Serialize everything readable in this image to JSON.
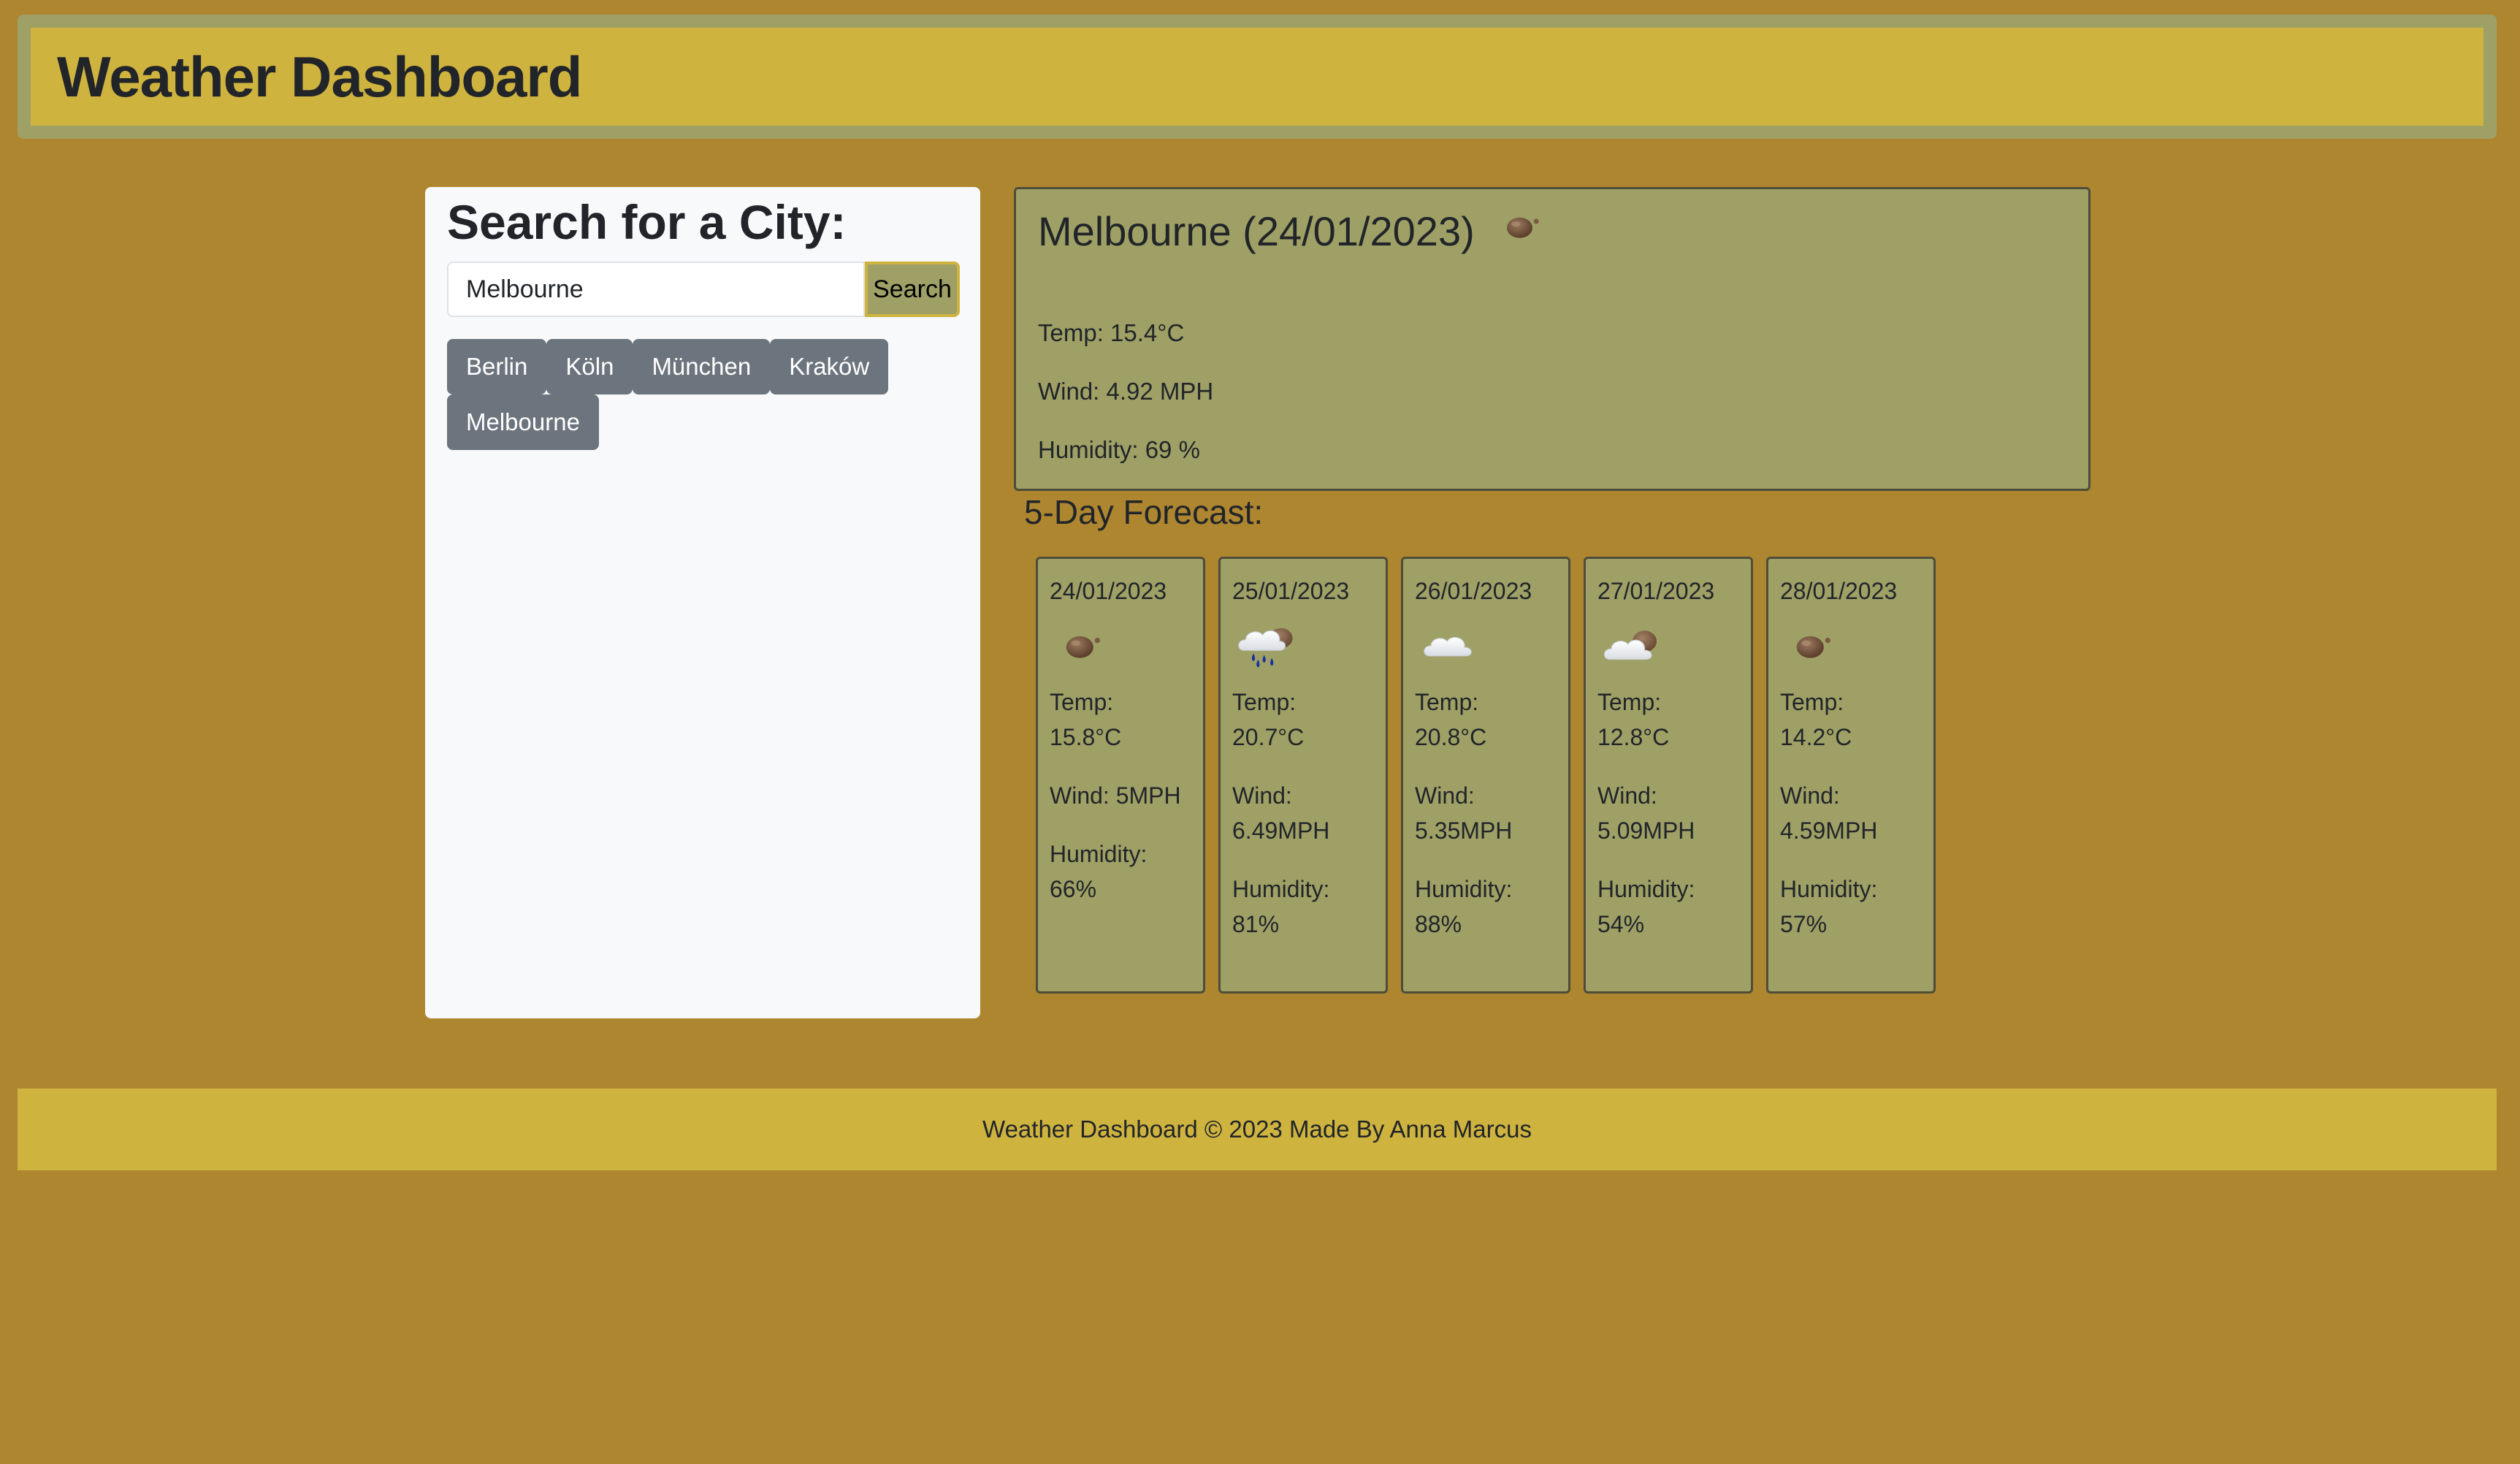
{
  "header": {
    "title": "Weather Dashboard"
  },
  "search": {
    "title": "Search for a City:",
    "input_value": "Melbourne",
    "button_label": "Search",
    "history": [
      "Berlin",
      "Köln",
      "München",
      "Kraków",
      "Melbourne"
    ]
  },
  "current": {
    "title": "Melbourne (24/01/2023)",
    "icon": "clear-night-icon",
    "temp": "Temp: 15.4°C",
    "wind": "Wind: 4.92 MPH",
    "humidity": "Humidity: 69 %"
  },
  "forecast": {
    "title": "5-Day Forecast:",
    "days": [
      {
        "date": "24/01/2023",
        "icon": "clear-night-icon",
        "temp": "Temp: 15.8°C",
        "wind": "Wind: 5MPH",
        "humidity": "Humidity: 66%"
      },
      {
        "date": "25/01/2023",
        "icon": "rain-night-icon",
        "temp": "Temp: 20.7°C",
        "wind": "Wind: 6.49MPH",
        "humidity": "Humidity: 81%"
      },
      {
        "date": "26/01/2023",
        "icon": "cloud-icon",
        "temp": "Temp: 20.8°C",
        "wind": "Wind: 5.35MPH",
        "humidity": "Humidity: 88%"
      },
      {
        "date": "27/01/2023",
        "icon": "cloudy-night-icon",
        "temp": "Temp: 12.8°C",
        "wind": "Wind: 5.09MPH",
        "humidity": "Humidity: 54%"
      },
      {
        "date": "28/01/2023",
        "icon": "clear-night-icon",
        "temp": "Temp: 14.2°C",
        "wind": "Wind: 4.59MPH",
        "humidity": "Humidity: 57%"
      }
    ]
  },
  "footer": {
    "text": "Weather Dashboard © 2023 Made By Anna Marcus"
  },
  "colors": {
    "background": "#af8630",
    "header_outer": "#9fa065",
    "header_inner": "#cfb33f",
    "panel": "#f8f9fa",
    "card": "#9fa065",
    "history_button": "#6c757d",
    "footer": "#cfb33f"
  }
}
